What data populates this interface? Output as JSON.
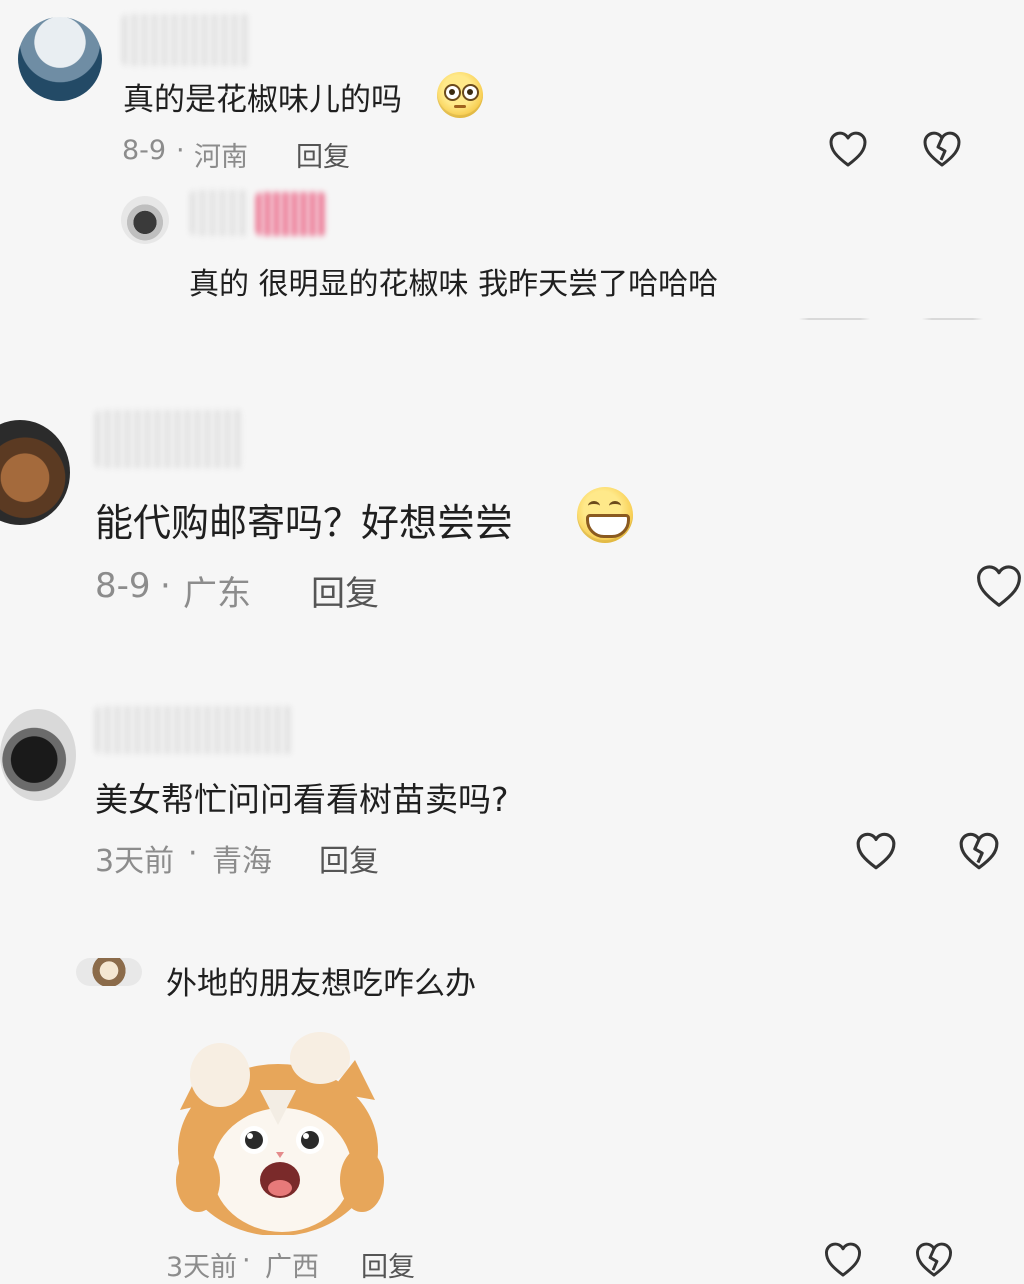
{
  "comments": [
    {
      "text": "真的是花椒味儿的吗",
      "date": "8-9",
      "location": "河南",
      "reply_label": "回复",
      "emoji": "flushed-face-emoji",
      "actions": [
        "like-heart-icon",
        "dislike-broken-heart-icon"
      ]
    },
    {
      "text": "真的 很明显的花椒味 我昨天尝了哈哈哈",
      "is_reply": true
    },
    {
      "text": "能代购邮寄吗？好想尝尝",
      "date": "8-9",
      "location": "广东",
      "reply_label": "回复",
      "emoji": "grinning-face-emoji",
      "actions": [
        "like-heart-icon"
      ]
    },
    {
      "text": "美女帮忙问问看看树苗卖吗?",
      "date": "3天前",
      "location": "青海",
      "reply_label": "回复",
      "actions": [
        "like-heart-icon",
        "dislike-broken-heart-icon"
      ]
    },
    {
      "text": "外地的朋友想吃咋么办",
      "date": "3天前",
      "location": "广西",
      "reply_label": "回复",
      "sticker": "surprised-cat-sticker",
      "actions": [
        "like-heart-icon",
        "dislike-broken-heart-icon"
      ]
    }
  ],
  "meta_separator": "·",
  "colors": {
    "background": "#f6f6f6",
    "text": "#1f1f1f",
    "meta": "#8c8c8c",
    "icon": "#333333",
    "emoji": "#f6c744"
  }
}
